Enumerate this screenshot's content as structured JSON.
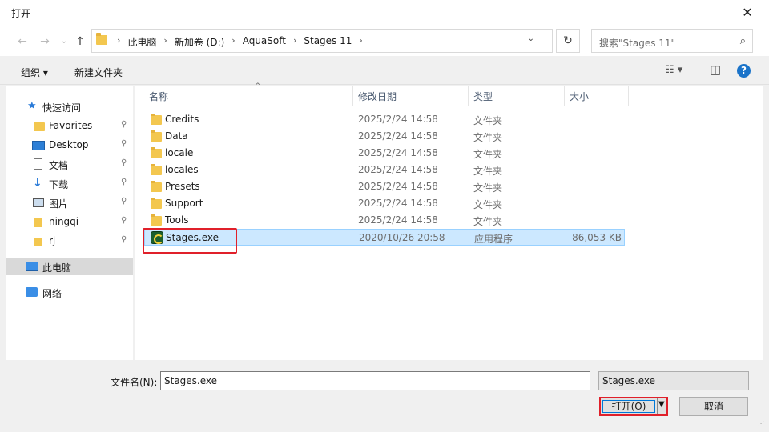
{
  "window": {
    "title": "打开",
    "close_glyph": "✕"
  },
  "nav": {
    "back_glyph": "←",
    "forward_glyph": "→",
    "recent_glyph": "⌄",
    "up_glyph": "↑",
    "breadcrumbs": [
      "此电脑",
      "新加卷 (D:)",
      "AquaSoft",
      "Stages 11"
    ],
    "separator": "›",
    "refresh_glyph": "↻",
    "search_placeholder": "搜索\"Stages 11\"",
    "search_glyph": "⌕"
  },
  "toolbar": {
    "organize_label": "组织 ▾",
    "new_folder_label": "新建文件夹",
    "view_glyph": "☷ ▾",
    "preview_glyph": "◫",
    "help_glyph": "?"
  },
  "sidebar": {
    "quick_access": "快速访问",
    "items": [
      {
        "label": "Favorites",
        "pinned": true
      },
      {
        "label": "Desktop",
        "pinned": true
      },
      {
        "label": "文档",
        "pinned": true
      },
      {
        "label": "下载",
        "pinned": true
      },
      {
        "label": "图片",
        "pinned": true
      },
      {
        "label": "ningqi",
        "pinned": true
      },
      {
        "label": "rj",
        "pinned": true
      }
    ],
    "this_pc": "此电脑",
    "network": "网络",
    "pin_glyph": "📌"
  },
  "columns": {
    "name": "名称",
    "date": "修改日期",
    "type": "类型",
    "size": "大小"
  },
  "files": [
    {
      "name": "Credits",
      "date": "2025/2/24 14:58",
      "type": "文件夹",
      "size": ""
    },
    {
      "name": "Data",
      "date": "2025/2/24 14:58",
      "type": "文件夹",
      "size": ""
    },
    {
      "name": "locale",
      "date": "2025/2/24 14:58",
      "type": "文件夹",
      "size": ""
    },
    {
      "name": "locales",
      "date": "2025/2/24 14:58",
      "type": "文件夹",
      "size": ""
    },
    {
      "name": "Presets",
      "date": "2025/2/24 14:58",
      "type": "文件夹",
      "size": ""
    },
    {
      "name": "Support",
      "date": "2025/2/24 14:58",
      "type": "文件夹",
      "size": ""
    },
    {
      "name": "Tools",
      "date": "2025/2/24 14:58",
      "type": "文件夹",
      "size": ""
    },
    {
      "name": "Stages.exe",
      "date": "2020/10/26 20:58",
      "type": "应用程序",
      "size": "86,053 KB"
    }
  ],
  "bottom": {
    "filename_label": "文件名(N):",
    "filename_value": "Stages.exe",
    "filetype_value": "Stages.exe",
    "open_label": "打开(O)",
    "cancel_label": "取消",
    "dropdown_glyph": "⌄"
  },
  "colors": {
    "accent": "#0078d7",
    "highlight_box": "#e0202a",
    "selection": "#cce8ff",
    "folder": "#f3c74f"
  }
}
